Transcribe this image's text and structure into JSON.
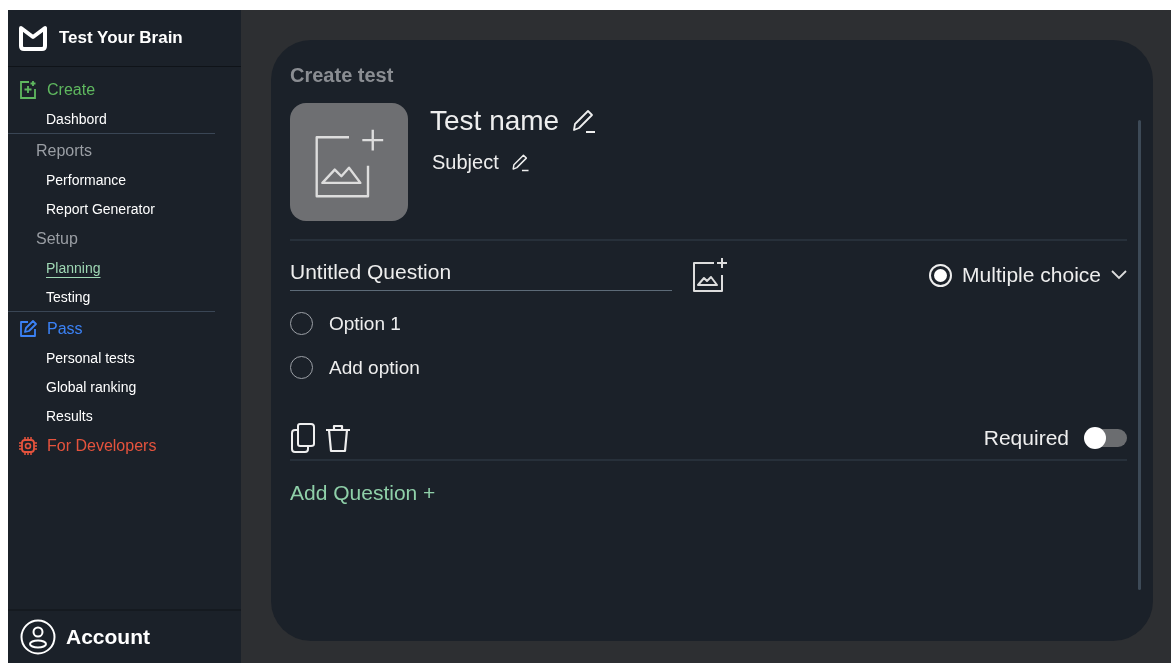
{
  "sidebar": {
    "app_title": "Test Your Brain",
    "sections": [
      {
        "kind": "primary",
        "label": "Create",
        "color": "#5fb85f",
        "items": [
          {
            "label": "Dashbord",
            "selected": false
          }
        ]
      },
      {
        "kind": "secondary",
        "label": "Reports",
        "items": [
          {
            "label": "Performance",
            "selected": false
          },
          {
            "label": "Report Generator",
            "selected": false
          }
        ]
      },
      {
        "kind": "secondary",
        "label": "Setup",
        "items": [
          {
            "label": "Planning",
            "selected": true
          },
          {
            "label": "Testing",
            "selected": false
          }
        ]
      },
      {
        "kind": "primary",
        "label": "Pass",
        "color": "#3b82f6",
        "items": [
          {
            "label": "Personal tests",
            "selected": false
          },
          {
            "label": "Global ranking",
            "selected": false
          },
          {
            "label": "Results",
            "selected": false
          }
        ]
      },
      {
        "kind": "primary",
        "label": "For Developers",
        "color": "#e5533d"
      }
    ],
    "account": "Account"
  },
  "card": {
    "title": "Create test",
    "test_name": "Test name",
    "subject": "Subject",
    "question": {
      "title": "Untitled Question",
      "type": "Multiple choice",
      "options": [
        {
          "label": "Option 1",
          "selected": false
        },
        {
          "label": "Add option",
          "selected": false
        }
      ],
      "required_label": "Required",
      "required": false
    },
    "add_question": "Add Question +"
  }
}
